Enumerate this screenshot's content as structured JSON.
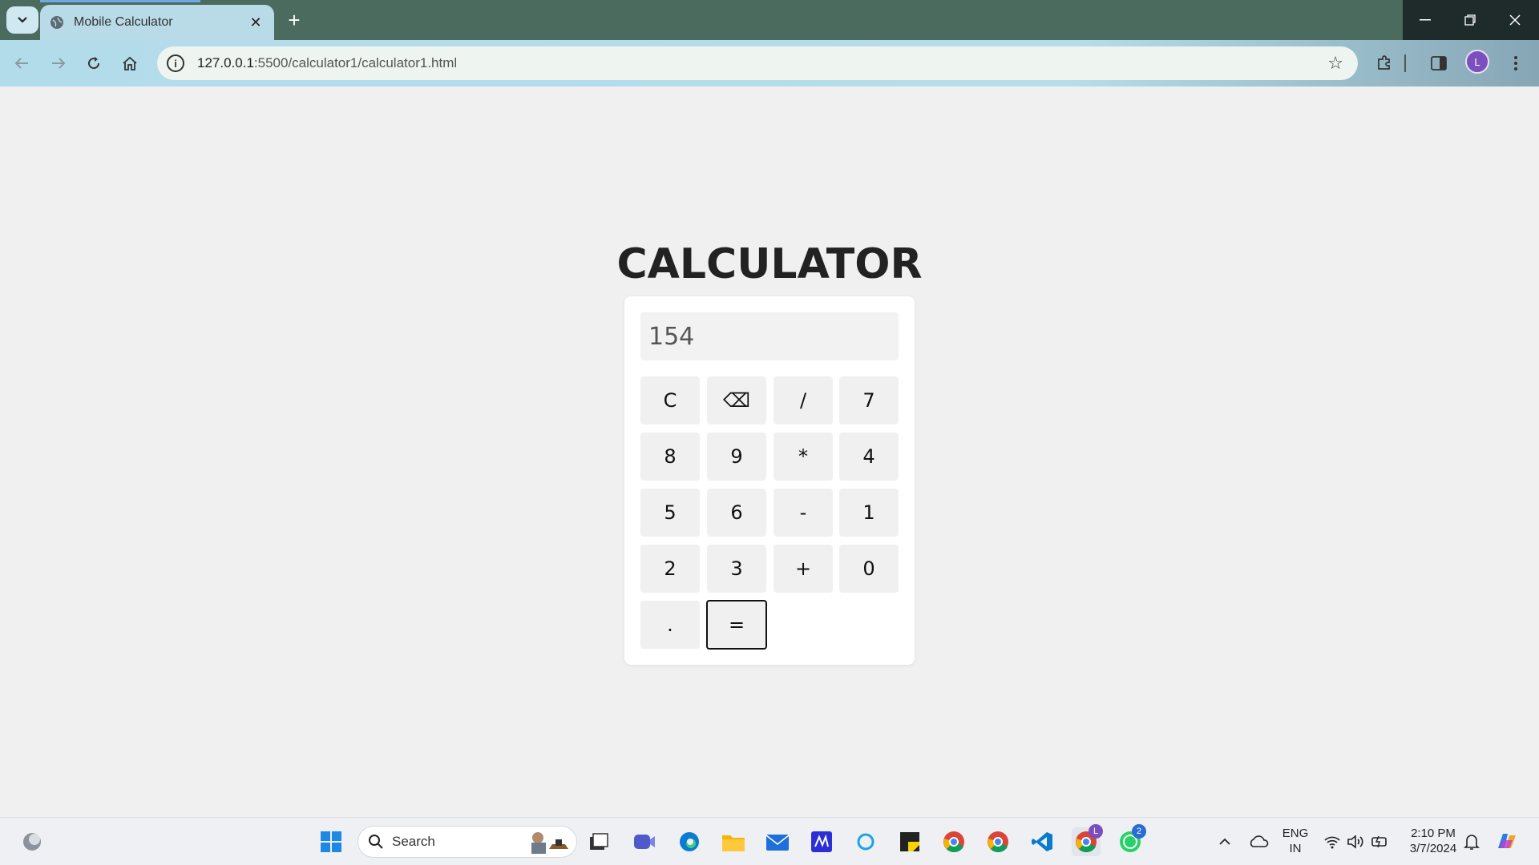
{
  "browser": {
    "tab_title": "Mobile Calculator",
    "url_host": "127.0.0.1",
    "url_rest": ":5500/calculator1/calculator1.html",
    "profile_initial": "L",
    "new_tab_symbol": "+",
    "tab_close_symbol": "✕"
  },
  "page": {
    "title": "CALCULATOR"
  },
  "calculator": {
    "display_value": "154",
    "keys": [
      "C",
      "⌫",
      "/",
      "7",
      "8",
      "9",
      "*",
      "4",
      "5",
      "6",
      "-",
      "1",
      "2",
      "3",
      "+",
      "0",
      ".",
      "="
    ]
  },
  "taskbar": {
    "search_label": "Search",
    "lang_line1": "ENG",
    "lang_line2": "IN",
    "time": "2:10 PM",
    "date": "3/7/2024",
    "chrome_badge": "L",
    "whatsapp_badge": "2"
  },
  "colors": {
    "tab_strip": "#4a6b5d",
    "page_bg": "#f0f0f0",
    "profile": "#7b4fbd"
  }
}
